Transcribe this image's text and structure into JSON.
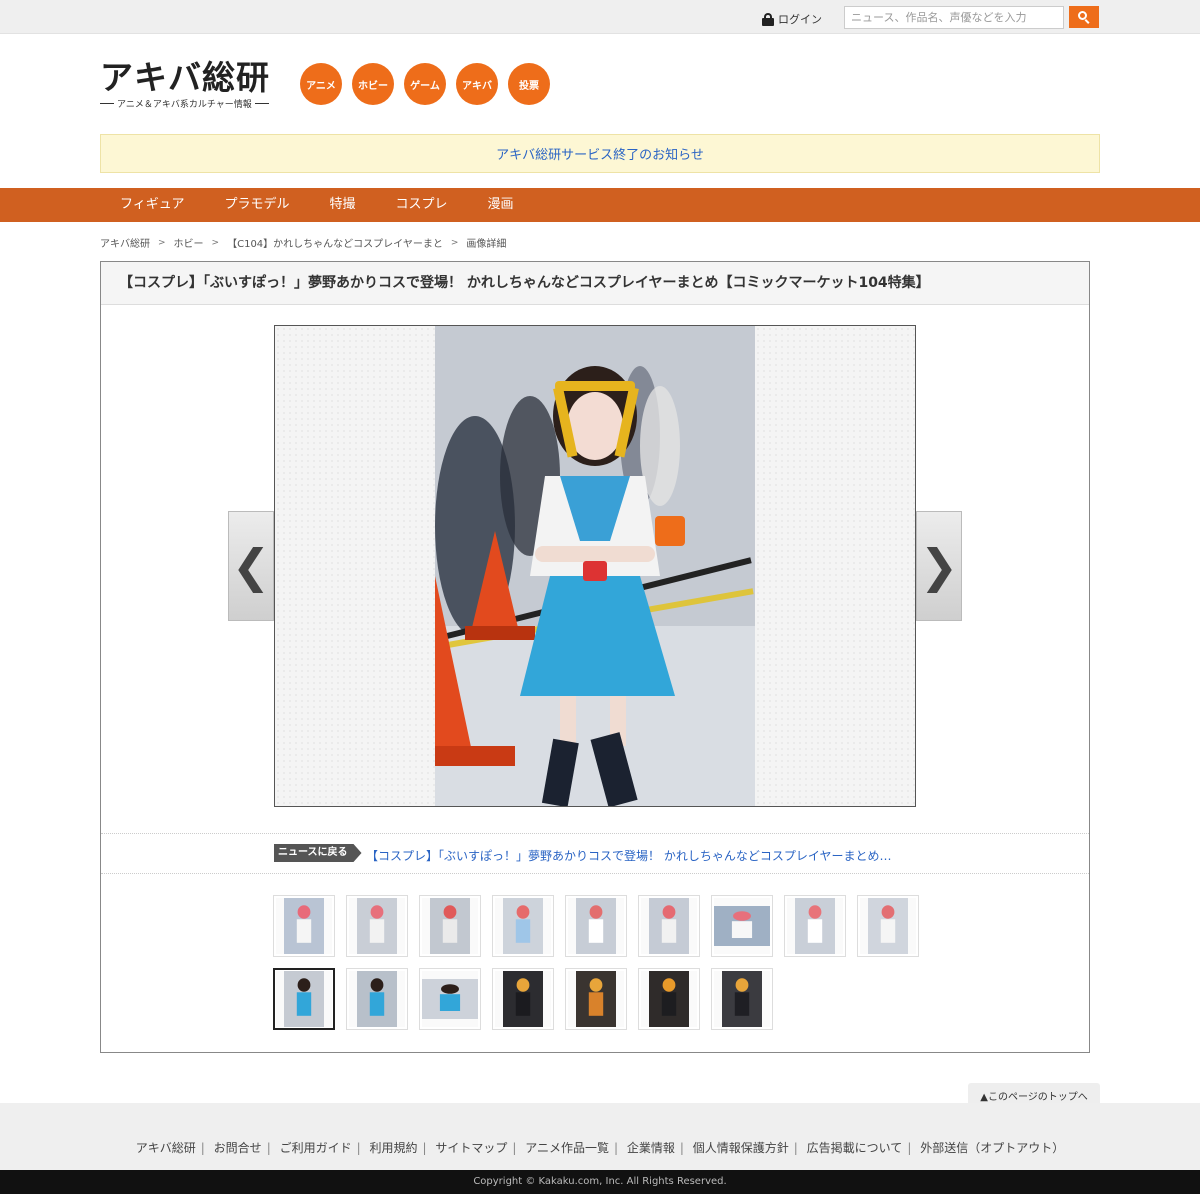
{
  "topbar": {
    "login_label": "ログイン",
    "search_placeholder": "ニュース、作品名、声優などを入力"
  },
  "header": {
    "logo_main": "アキバ総研",
    "logo_sub": "アニメ＆アキバ系カルチャー情報",
    "categories": [
      "アニメ",
      "ホビー",
      "ゲーム",
      "アキバ",
      "投票"
    ],
    "notice": "アキバ総研サービス終了のお知らせ"
  },
  "nav": {
    "items": [
      "フィギュア",
      "プラモデル",
      "特撮",
      "コスプレ",
      "漫画"
    ]
  },
  "breadcrumb": [
    "アキバ総研",
    "ホビー",
    "【C104】かれしちゃんなどコスプレイヤーまと",
    "画像詳細"
  ],
  "article": {
    "title": "【コスプレ】「ぶいすぽっ！」夢野あかりコスで登場！ かれしちゃんなどコスプレイヤーまとめ【コミックマーケット104特集】",
    "prev_label": "❮",
    "next_label": "❯",
    "back_tag": "ニュースに戻る",
    "back_link": "【コスプレ】「ぶいすぽっ！」夢野あかりコスで登場！ かれしちゃんなどコスプレイヤーまとめ…",
    "thumbnail_count": 16,
    "active_thumbnail": 10
  },
  "pagetop_label": "▲このページのトップへ",
  "footer": {
    "links": [
      "アキバ総研",
      "お問合せ",
      "ご利用ガイド",
      "利用規約",
      "サイトマップ",
      "アニメ作品一覧",
      "企業情報",
      "個人情報保護方針",
      "広告掲載について",
      "外部送信（オプトアウト）"
    ],
    "copyright": "Copyright © Kakaku.com, Inc. All Rights Reserved."
  },
  "colors": {
    "accent": "#ee6d1a",
    "nav": "#d06020",
    "link": "#2a64c4",
    "notice_bg": "#fdf7d4"
  }
}
